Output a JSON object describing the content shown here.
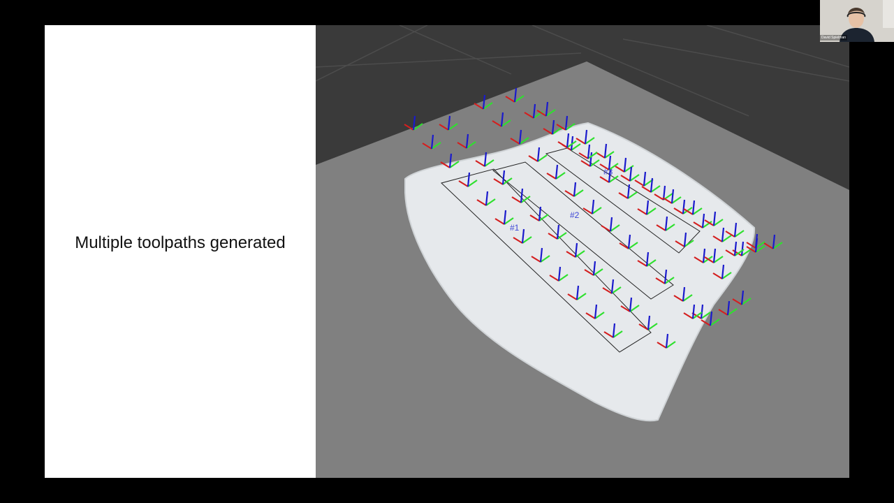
{
  "slide": {
    "caption": "Multiple toolpaths generated"
  },
  "viewport": {
    "toolpath_labels": [
      "#1",
      "#2",
      "#3"
    ]
  },
  "webcam": {
    "participant_name": "David Spielman"
  },
  "colors": {
    "axis_x": "#d41f1f",
    "axis_y": "#2ee02e",
    "axis_z": "#1a1acc",
    "label": "#3b45d6",
    "floor": "#808080",
    "background": "#3a3a3a"
  }
}
